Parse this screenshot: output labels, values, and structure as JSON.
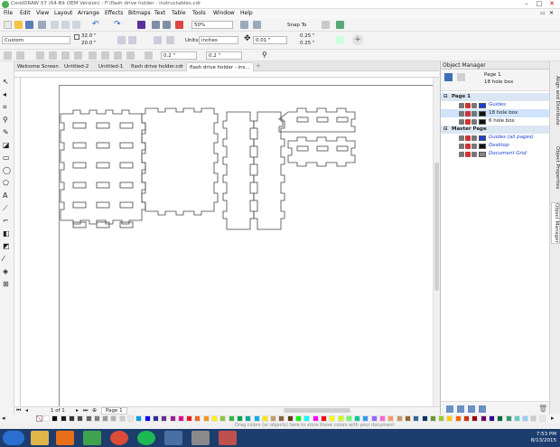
{
  "window": {
    "title": "CorelDRAW X7 (64-Bit OEM Version) - F:\\flash drive holder - instructables.cdr"
  },
  "menu": [
    "File",
    "Edit",
    "View",
    "Layout",
    "Arrange",
    "Effects",
    "Bitmaps",
    "Text",
    "Table",
    "Tools",
    "Window",
    "Help"
  ],
  "toolbar1": {
    "zoom": "50%",
    "snap_to": "Snap To"
  },
  "propbar": {
    "page_size": "Custom",
    "width": "32.0 \"",
    "height": "20.0 \"",
    "units_label": "Units:",
    "units": "inches",
    "nudge": "0.01 \"",
    "dup_x": "0.25 \"",
    "dup_y": "0.25 \""
  },
  "toolbar3": {
    "offset_x": "0.2 \"",
    "offset_y": "0.2 \""
  },
  "tabs": [
    {
      "label": "Welcome Screen"
    },
    {
      "label": "Untitled-2"
    },
    {
      "label": "Untitled-1"
    },
    {
      "label": "flash drive holder.cdr"
    },
    {
      "label": "flash drive holder - ins..."
    }
  ],
  "object_manager": {
    "title": "Object Manager",
    "current_page": "Page 1",
    "current_layer": "18 hole box",
    "rows": [
      {
        "name": "Page 1",
        "type": "page"
      },
      {
        "name": "Guides",
        "type": "layer",
        "color": "#1b3fd8"
      },
      {
        "name": "18 hole box",
        "type": "layer",
        "color": "#111111",
        "selected": true
      },
      {
        "name": "6 hole box",
        "type": "layer",
        "color": "#111111"
      },
      {
        "name": "Master Page",
        "type": "page"
      },
      {
        "name": "Guides (all pages)",
        "type": "master",
        "color": "#1b3fd8"
      },
      {
        "name": "Desktop",
        "type": "master",
        "color": "#111111"
      },
      {
        "name": "Document Grid",
        "type": "master",
        "color": "#888888"
      }
    ]
  },
  "side_tabs": [
    "Align and Distribute",
    "Object Properties",
    "Object Manager"
  ],
  "page_nav": {
    "counter": "1 of 1",
    "page_tab": "Page 1"
  },
  "status": {
    "hint": "Drag colors (or objects) here to store these colors with your document"
  },
  "clock": {
    "time": "7:53 PM",
    "date": "8/13/2015"
  },
  "palette": [
    "#ffffff",
    "#000000",
    "#1a1a1a",
    "#333333",
    "#4d4d4d",
    "#666666",
    "#808080",
    "#999999",
    "#b3b3b3",
    "#cccccc",
    "#e6e6e6",
    "#00a0e9",
    "#0000ff",
    "#2e3192",
    "#662d91",
    "#92278f",
    "#ec008c",
    "#ed1c24",
    "#f26522",
    "#f7941d",
    "#fff200",
    "#8dc63f",
    "#39b54a",
    "#00a651",
    "#00a99d",
    "#00aeef",
    "#ffe600",
    "#c69c6d",
    "#8c6239",
    "#603913",
    "#00ff00",
    "#00ffff",
    "#ff00ff",
    "#ff0000",
    "#ffff00",
    "#ccff00",
    "#66ff66",
    "#00cc99",
    "#3399ff",
    "#9966ff",
    "#ff66cc",
    "#ff9966",
    "#cc9966",
    "#996633",
    "#336699",
    "#003366",
    "#669933",
    "#99cc33",
    "#ffcc00",
    "#ff6600",
    "#cc3300",
    "#990000",
    "#660066",
    "#330099",
    "#006633",
    "#339966",
    "#66cccc",
    "#99ccff",
    "#cccccc",
    "#e6e6e6"
  ]
}
